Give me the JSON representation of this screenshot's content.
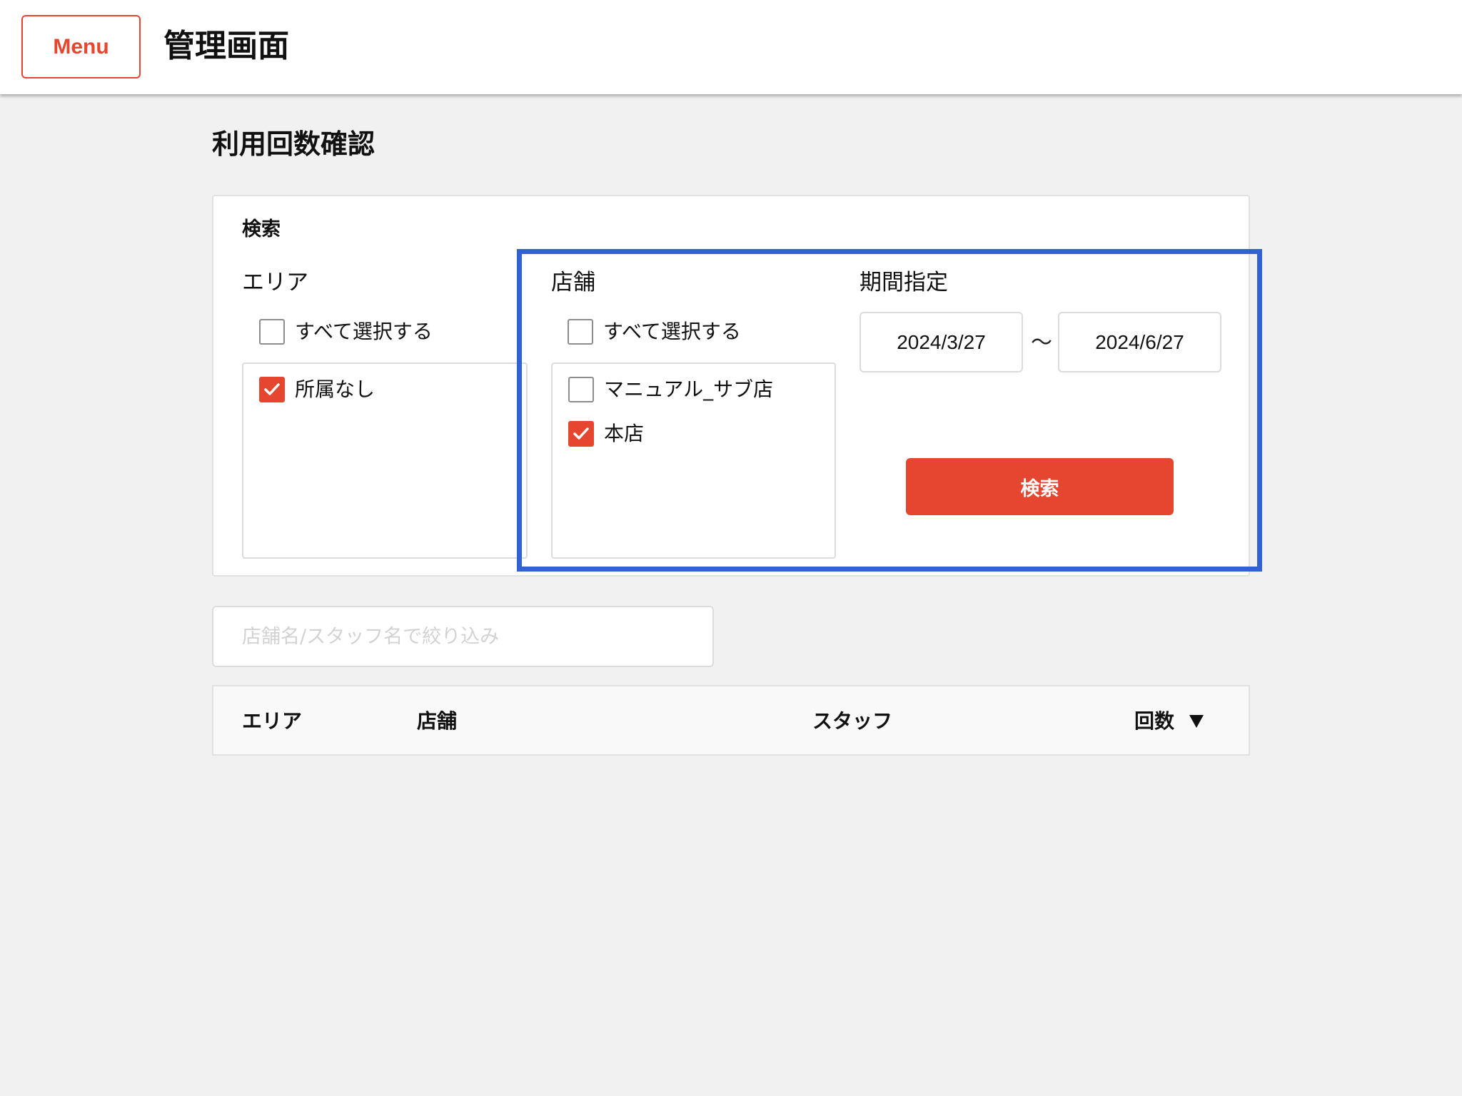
{
  "header": {
    "menu_label": "Menu",
    "app_title": "管理画面"
  },
  "page": {
    "title": "利用回数確認"
  },
  "search": {
    "heading": "検索",
    "area": {
      "label": "エリア",
      "select_all": {
        "label": "すべて選択する",
        "checked": false
      },
      "options": [
        {
          "label": "所属なし",
          "checked": true
        }
      ]
    },
    "store": {
      "label": "店舗",
      "select_all": {
        "label": "すべて選択する",
        "checked": false
      },
      "options": [
        {
          "label": "マニュアル_サブ店",
          "checked": false
        },
        {
          "label": "本店",
          "checked": true
        }
      ]
    },
    "period": {
      "label": "期間指定",
      "start": "2024/3/27",
      "separator": "〜",
      "end": "2024/6/27"
    },
    "button_label": "検索"
  },
  "filter": {
    "placeholder": "店舗名/スタッフ名で絞り込み",
    "value": ""
  },
  "table": {
    "columns": [
      "エリア",
      "店舗",
      "スタッフ",
      "回数"
    ],
    "sort_icon": "triangle-down-icon"
  },
  "colors": {
    "accent": "#e64630",
    "highlight": "#3162d4",
    "background": "#f1f1f1"
  }
}
